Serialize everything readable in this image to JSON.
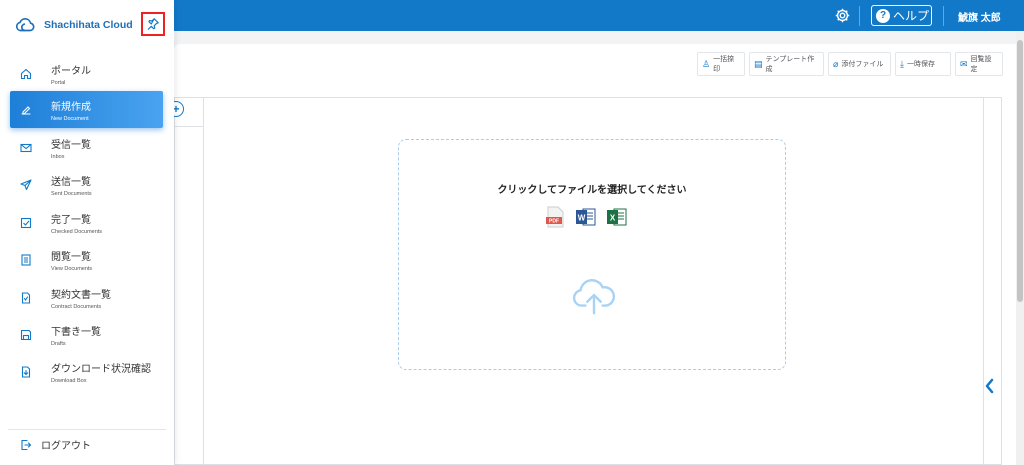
{
  "brand": {
    "name": "Shachihata Cloud",
    "logo_icon": "cloud-logo-icon",
    "pin_icon": "pin-icon"
  },
  "header": {
    "help_label": "ヘルプ",
    "user_name": "鯱旗 太郎",
    "settings_icon": "gear-icon"
  },
  "nav": {
    "items": [
      {
        "label": "ポータル",
        "sub": "Portal",
        "icon": "home-icon"
      },
      {
        "label": "新規作成",
        "sub": "New Document",
        "icon": "pen-icon"
      },
      {
        "label": "受信一覧",
        "sub": "Inbox",
        "icon": "envelope-icon"
      },
      {
        "label": "送信一覧",
        "sub": "Sent Documents",
        "icon": "send-icon"
      },
      {
        "label": "完了一覧",
        "sub": "Checked Documents",
        "icon": "check-square-icon"
      },
      {
        "label": "閲覧一覧",
        "sub": "View Documents",
        "icon": "list-doc-icon"
      },
      {
        "label": "契約文書一覧",
        "sub": "Contract Documents",
        "icon": "contract-icon"
      },
      {
        "label": "下書き一覧",
        "sub": "Drafts",
        "icon": "save-icon"
      },
      {
        "label": "ダウンロード状況確認",
        "sub": "Download Box",
        "icon": "download-icon"
      }
    ],
    "active_index": 1,
    "logout_label": "ログアウト"
  },
  "toolbar": {
    "batch_stamp": "一括捺印",
    "template": "テンプレート作成",
    "attachment": "添付ファイル",
    "temp_save": "一時保存",
    "circulation": "回覧設定"
  },
  "upload": {
    "prompt": "クリックしてファイルを選択してください",
    "file_types": [
      "PDF",
      "W",
      "X"
    ]
  },
  "colors": {
    "primary": "#1279c9",
    "active_gradient_start": "#1e7fd8",
    "active_gradient_end": "#4aa3f0",
    "highlight_border": "#e22222"
  }
}
